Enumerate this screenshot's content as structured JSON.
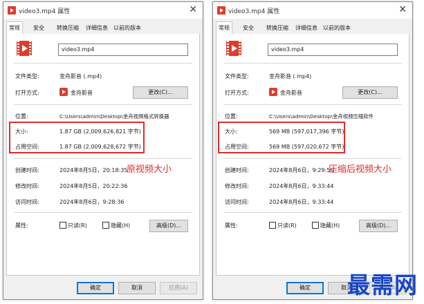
{
  "dialogs": [
    {
      "title": "video3.mp4 属性",
      "close_glyph": "✕",
      "tabs": [
        "常规",
        "安全",
        "转换压缩",
        "详细信息",
        "以前的版本"
      ],
      "filename": "video3.mp4",
      "file_type_label": "文件类型:",
      "file_type_value": "金舟影音 (.mp4)",
      "open_with_label": "打开方式:",
      "open_with_value": "金舟影音",
      "change_button": "更改(C)...",
      "location_label": "位置:",
      "location_value": "C:\\Users\\admin\\Desktop\\金舟视频格式转换器",
      "size_label": "大小:",
      "size_value": "1.87 GB (2,009,626,821 字节)",
      "disk_size_label": "占用空间:",
      "disk_size_value": "1.87 GB (2,009,628,672 字节)",
      "created_label": "创建时间:",
      "created_value": "2024年8月5日，20:18:35",
      "modified_label": "修改时间:",
      "modified_value": "2024年8月5日，20:22:36",
      "accessed_label": "访问时间:",
      "accessed_value": "2024年8月6日，9:28:36",
      "attributes_label": "属性:",
      "readonly_label": "只读(R)",
      "hidden_label": "隐藏(H)",
      "advanced_button": "高级(D)...",
      "ok_button": "确定",
      "cancel_button": "取消",
      "apply_button": "应用(A)",
      "annotation": "原视频大小"
    },
    {
      "title": "video3.mp4 属性",
      "close_glyph": "✕",
      "tabs": [
        "常规",
        "安全",
        "转换压缩",
        "详细信息",
        "以前的版本"
      ],
      "filename": "video3.mp4",
      "file_type_label": "文件类型:",
      "file_type_value": "金舟影音 (.mp4)",
      "open_with_label": "打开方式:",
      "open_with_value": "金舟影音",
      "change_button": "更改(C)...",
      "location_label": "位置:",
      "location_value": "C:\\Users\\admin\\Desktop\\金舟视频压缩软件",
      "size_label": "大小:",
      "size_value": "569 MB (597,017,396 字节)",
      "disk_size_label": "占用空间:",
      "disk_size_value": "569 MB (597,020,672 字节)",
      "created_label": "创建时间:",
      "created_value": "2024年8月6日，9:29:56",
      "modified_label": "修改时间:",
      "modified_value": "2024年8月6日，9:33:44",
      "accessed_label": "访问时间:",
      "accessed_value": "2024年8月6日，9:33:44",
      "attributes_label": "属性:",
      "readonly_label": "只读(R)",
      "hidden_label": "隐藏(H)",
      "advanced_button": "高级(D)...",
      "ok_button": "确定",
      "cancel_button": "取消",
      "apply_button": "应用(A)",
      "annotation": "压缩后视频大小"
    }
  ],
  "watermark": "最需网",
  "colors": {
    "highlight": "#e02a2a",
    "accent": "#0078d7",
    "app_icon": "#e03c2b",
    "watermark": "#1846c8"
  }
}
